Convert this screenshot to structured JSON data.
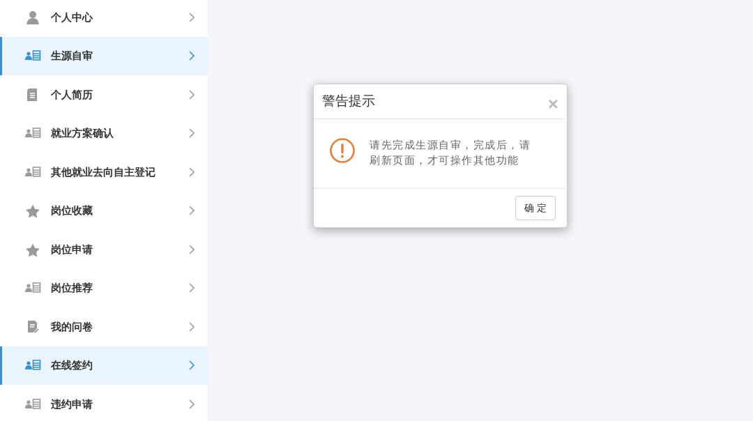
{
  "sidebar": {
    "items": [
      {
        "label": "个人中心",
        "kind": "person",
        "selected": false
      },
      {
        "label": "生源自审",
        "kind": "card",
        "selected": true
      },
      {
        "label": "个人简历",
        "kind": "document",
        "selected": false
      },
      {
        "label": "就业方案确认",
        "kind": "card",
        "selected": false
      },
      {
        "label": "其他就业去向自主登记",
        "kind": "card",
        "selected": false
      },
      {
        "label": "岗位收藏",
        "kind": "star",
        "selected": false
      },
      {
        "label": "岗位申请",
        "kind": "star",
        "selected": false
      },
      {
        "label": "岗位推荐",
        "kind": "card",
        "selected": false
      },
      {
        "label": "我的问卷",
        "kind": "survey",
        "selected": false
      },
      {
        "label": "在线签约",
        "kind": "card",
        "selected": true
      },
      {
        "label": "违约申请",
        "kind": "card",
        "selected": false
      }
    ]
  },
  "dialog": {
    "title": "警告提示",
    "close": "×",
    "message": "请先完成生源自审，完成后，请刷新页面，才可操作其他功能",
    "button": "确 定"
  }
}
